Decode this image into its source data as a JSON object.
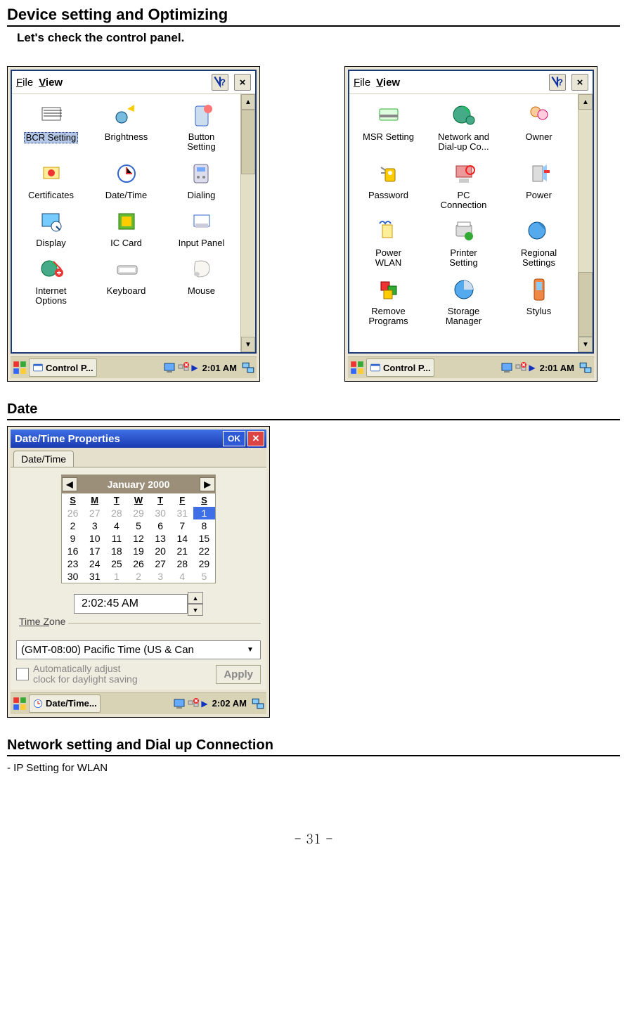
{
  "heading1": "Device setting and Optimizing",
  "subintro": "Let's check the control panel.",
  "heading_date": "Date",
  "heading_network": "Network setting and Dial up Connection",
  "body_network": "- IP Setting for WLAN",
  "pagenum": "- 31 -",
  "menubar": {
    "file": "File",
    "view": "View",
    "help_tooltip": "?",
    "close_tooltip": "×"
  },
  "panel1": {
    "items": [
      {
        "label": "BCR Setting",
        "selected": true
      },
      {
        "label": "Brightness"
      },
      {
        "label": "Button\nSetting"
      },
      {
        "label": "Certificates"
      },
      {
        "label": "Date/Time"
      },
      {
        "label": "Dialing"
      },
      {
        "label": "Display"
      },
      {
        "label": "IC Card"
      },
      {
        "label": "Input Panel"
      },
      {
        "label": "Internet\nOptions"
      },
      {
        "label": "Keyboard"
      },
      {
        "label": "Mouse"
      }
    ],
    "taskbar_label": "Control P...",
    "clock": "2:01 AM"
  },
  "panel2": {
    "items": [
      {
        "label": "MSR Setting"
      },
      {
        "label": "Network and\nDial-up Co..."
      },
      {
        "label": "Owner"
      },
      {
        "label": "Password"
      },
      {
        "label": "PC\nConnection"
      },
      {
        "label": "Power"
      },
      {
        "label": "Power\nWLAN"
      },
      {
        "label": "Printer\nSetting"
      },
      {
        "label": "Regional\nSettings"
      },
      {
        "label": "Remove\nPrograms"
      },
      {
        "label": "Storage\nManager"
      },
      {
        "label": "Stylus"
      }
    ],
    "taskbar_label": "Control P...",
    "clock": "2:01 AM"
  },
  "datetime": {
    "title": "Date/Time Properties",
    "ok": "OK",
    "tab": "Date/Time",
    "month_label": "January 2000",
    "dow": [
      "S",
      "M",
      "T",
      "W",
      "T",
      "F",
      "S"
    ],
    "cells": [
      {
        "d": "26",
        "out": true
      },
      {
        "d": "27",
        "out": true
      },
      {
        "d": "28",
        "out": true
      },
      {
        "d": "29",
        "out": true
      },
      {
        "d": "30",
        "out": true
      },
      {
        "d": "31",
        "out": true
      },
      {
        "d": "1",
        "sel": true
      },
      {
        "d": "2"
      },
      {
        "d": "3"
      },
      {
        "d": "4"
      },
      {
        "d": "5"
      },
      {
        "d": "6"
      },
      {
        "d": "7"
      },
      {
        "d": "8"
      },
      {
        "d": "9"
      },
      {
        "d": "10"
      },
      {
        "d": "11"
      },
      {
        "d": "12"
      },
      {
        "d": "13"
      },
      {
        "d": "14"
      },
      {
        "d": "15"
      },
      {
        "d": "16"
      },
      {
        "d": "17"
      },
      {
        "d": "18"
      },
      {
        "d": "19"
      },
      {
        "d": "20"
      },
      {
        "d": "21"
      },
      {
        "d": "22"
      },
      {
        "d": "23"
      },
      {
        "d": "24"
      },
      {
        "d": "25"
      },
      {
        "d": "26"
      },
      {
        "d": "27"
      },
      {
        "d": "28"
      },
      {
        "d": "29"
      },
      {
        "d": "30"
      },
      {
        "d": "31"
      },
      {
        "d": "1",
        "out": true
      },
      {
        "d": "2",
        "out": true
      },
      {
        "d": "3",
        "out": true
      },
      {
        "d": "4",
        "out": true
      },
      {
        "d": "5",
        "out": true
      }
    ],
    "time_value": "2:02:45 AM",
    "timezone_label": "Time Zone",
    "timezone_value": "(GMT-08:00) Pacific Time (US & Can",
    "auto_label": "Automatically adjust\nclock for daylight saving",
    "apply_label": "Apply",
    "taskbar_label": "Date/Time...",
    "clock": "2:02 AM"
  }
}
